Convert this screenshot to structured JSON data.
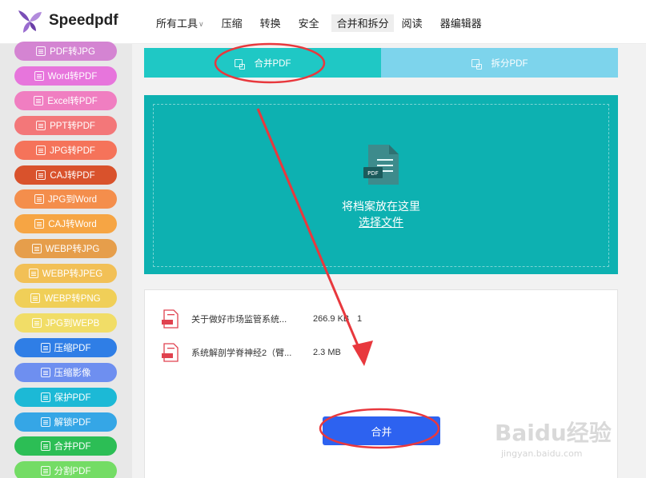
{
  "header": {
    "brand": "Speedpdf",
    "nav": [
      {
        "label": "所有工具",
        "caret": true
      },
      {
        "label": "压缩"
      },
      {
        "label": "转换"
      },
      {
        "label": "安全"
      },
      {
        "label": "合并和拆分",
        "active": true
      },
      {
        "label": "阅读"
      },
      {
        "label": "器编辑器"
      }
    ]
  },
  "sidebar": {
    "tools": [
      {
        "label": "PDF转JPG",
        "color": "#d484d2",
        "icon": "image-icon"
      },
      {
        "label": "Word转PDF",
        "color": "#e775dc",
        "icon": "word-icon"
      },
      {
        "label": "Excel转PDF",
        "color": "#f07ec1",
        "icon": "excel-icon"
      },
      {
        "label": "PPT转PDF",
        "color": "#f37779",
        "icon": "ppt-icon"
      },
      {
        "label": "JPG转PDF",
        "color": "#f5735a",
        "icon": "image-icon"
      },
      {
        "label": "CAJ转PDF",
        "color": "#d9522c",
        "icon": "caj-icon"
      },
      {
        "label": "JPG到Word",
        "color": "#f48e4c",
        "icon": "image-icon"
      },
      {
        "label": "CAJ转Word",
        "color": "#f6a544",
        "icon": "caj-icon"
      },
      {
        "label": "WEBP转JPG",
        "color": "#e69e4b",
        "icon": "image-icon"
      },
      {
        "label": "WEBP转JPEG",
        "color": "#f2c056",
        "icon": "image-icon"
      },
      {
        "label": "WEBP转PNG",
        "color": "#f0cf58",
        "icon": "image-icon"
      },
      {
        "label": "JPG到WEPB",
        "color": "#f1dd67",
        "icon": "image-icon"
      },
      {
        "label": "压缩PDF",
        "color": "#2f7ee6",
        "icon": "compress-icon"
      },
      {
        "label": "压缩影像",
        "color": "#6e8ff0",
        "icon": "compress-icon"
      },
      {
        "label": "保护PDF",
        "color": "#1cb9d6",
        "icon": "lock-icon"
      },
      {
        "label": "解锁PDF",
        "color": "#35a6e6",
        "icon": "unlock-icon"
      },
      {
        "label": "合并PDF",
        "color": "#2cbe55",
        "icon": "merge-icon"
      },
      {
        "label": "分割PDF",
        "color": "#74dc65",
        "icon": "split-icon"
      }
    ]
  },
  "tabs": {
    "merge": "合并PDF",
    "split": "拆分PDF"
  },
  "dropzone": {
    "text": "将档案放在这里",
    "link": "选择文件",
    "doc_badge": "PDF"
  },
  "files": [
    {
      "name": "关于做好市场监管系统...",
      "size": "266.9 KB",
      "pages": "1"
    },
    {
      "name": "系统解剖学脊神经2（臂...",
      "size": "2.3 MB",
      "pages": ""
    }
  ],
  "merge_button": "合并",
  "watermark": {
    "logo": "Baidu经验",
    "url": "jingyan.baidu.com"
  },
  "colors": {
    "tab_active": "#1fc8c5",
    "tab_inactive": "#7dd4ec",
    "dropzone": "#0db1b1",
    "merge_button": "#2d62f0",
    "annotation": "#e8383d"
  }
}
